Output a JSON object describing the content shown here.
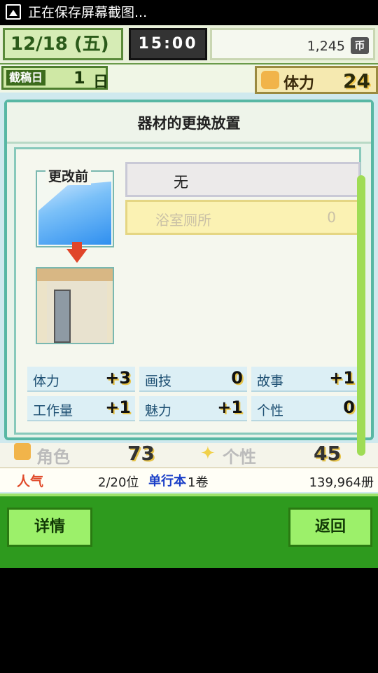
{
  "status_bar": {
    "text": "正在保存屏幕截图..."
  },
  "top": {
    "date": "12/18 (五)",
    "time": "15:00",
    "money": "1,245",
    "currency_icon": "币"
  },
  "info": {
    "deadline_label": "截稿日",
    "deadline_value": "1",
    "deadline_unit": "日",
    "stamina_label": "体力",
    "stamina_value": "24"
  },
  "dialog": {
    "title": "器材的更换放置",
    "before_label": "更改前",
    "options": [
      {
        "name": "无"
      },
      {
        "name": "浴室厕所",
        "count": "0"
      }
    ],
    "stats": [
      {
        "label": "体力",
        "value": "+3"
      },
      {
        "label": "画技",
        "value": "0"
      },
      {
        "label": "故事",
        "value": "+1"
      },
      {
        "label": "工作量",
        "value": "+1"
      },
      {
        "label": "魅力",
        "value": "+1"
      },
      {
        "label": "个性",
        "value": "0"
      }
    ]
  },
  "background": {
    "role_label": "角色",
    "role_value": "73",
    "personality_label": "个性",
    "personality_value": "45",
    "popularity_label": "人气",
    "rank": "2/20位",
    "volume_label": "单行本",
    "volume": "1卷",
    "copies": "139,964册"
  },
  "buttons": {
    "detail": "详情",
    "back": "返回"
  }
}
